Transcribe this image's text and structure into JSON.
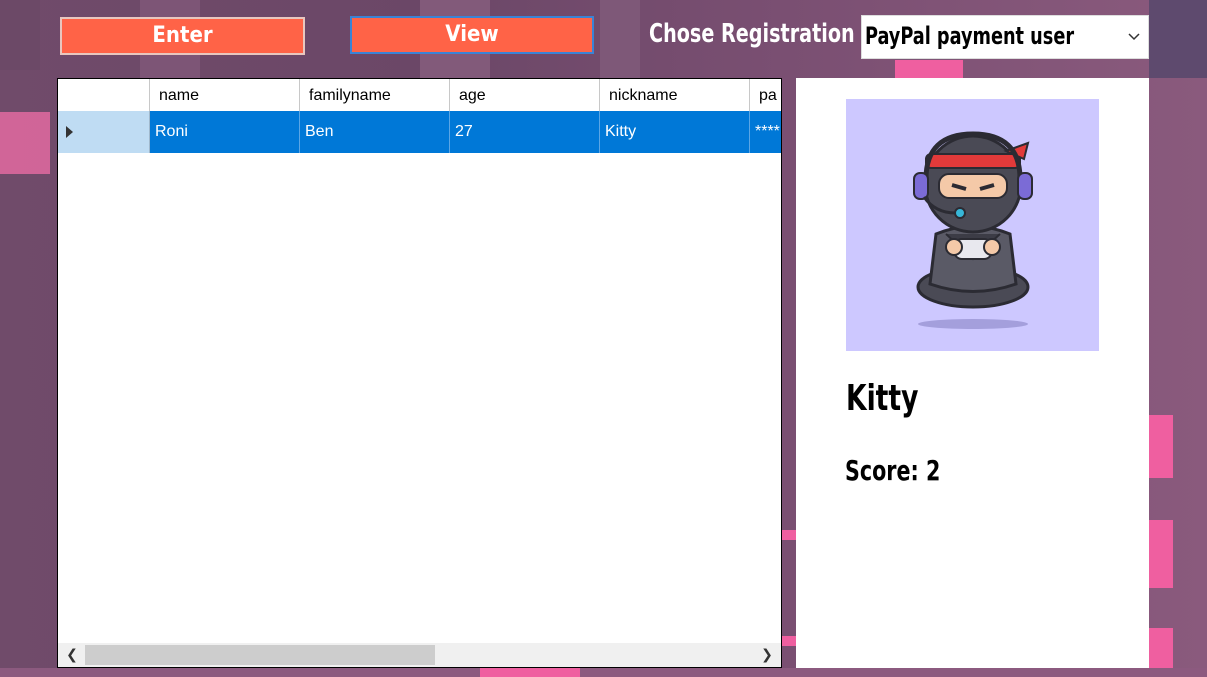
{
  "toolbar": {
    "enter_label": "Enter",
    "view_label": "View",
    "registration_label": "Chose Registration",
    "registration_selected": "PayPal payment user"
  },
  "grid": {
    "columns": [
      "name",
      "familyname",
      "age",
      "nickname",
      "pa"
    ],
    "rows": [
      {
        "name": "Roni",
        "familyname": "Ben",
        "age": "27",
        "nickname": "Kitty",
        "password": "****"
      }
    ]
  },
  "card": {
    "nickname": "Kitty",
    "score_text": "Score: 2",
    "avatar_icon": "ninja-gamer-avatar"
  },
  "colors": {
    "button": "#ff6347",
    "selection": "#0078d7",
    "avatar_bg": "#cdc8ff"
  }
}
